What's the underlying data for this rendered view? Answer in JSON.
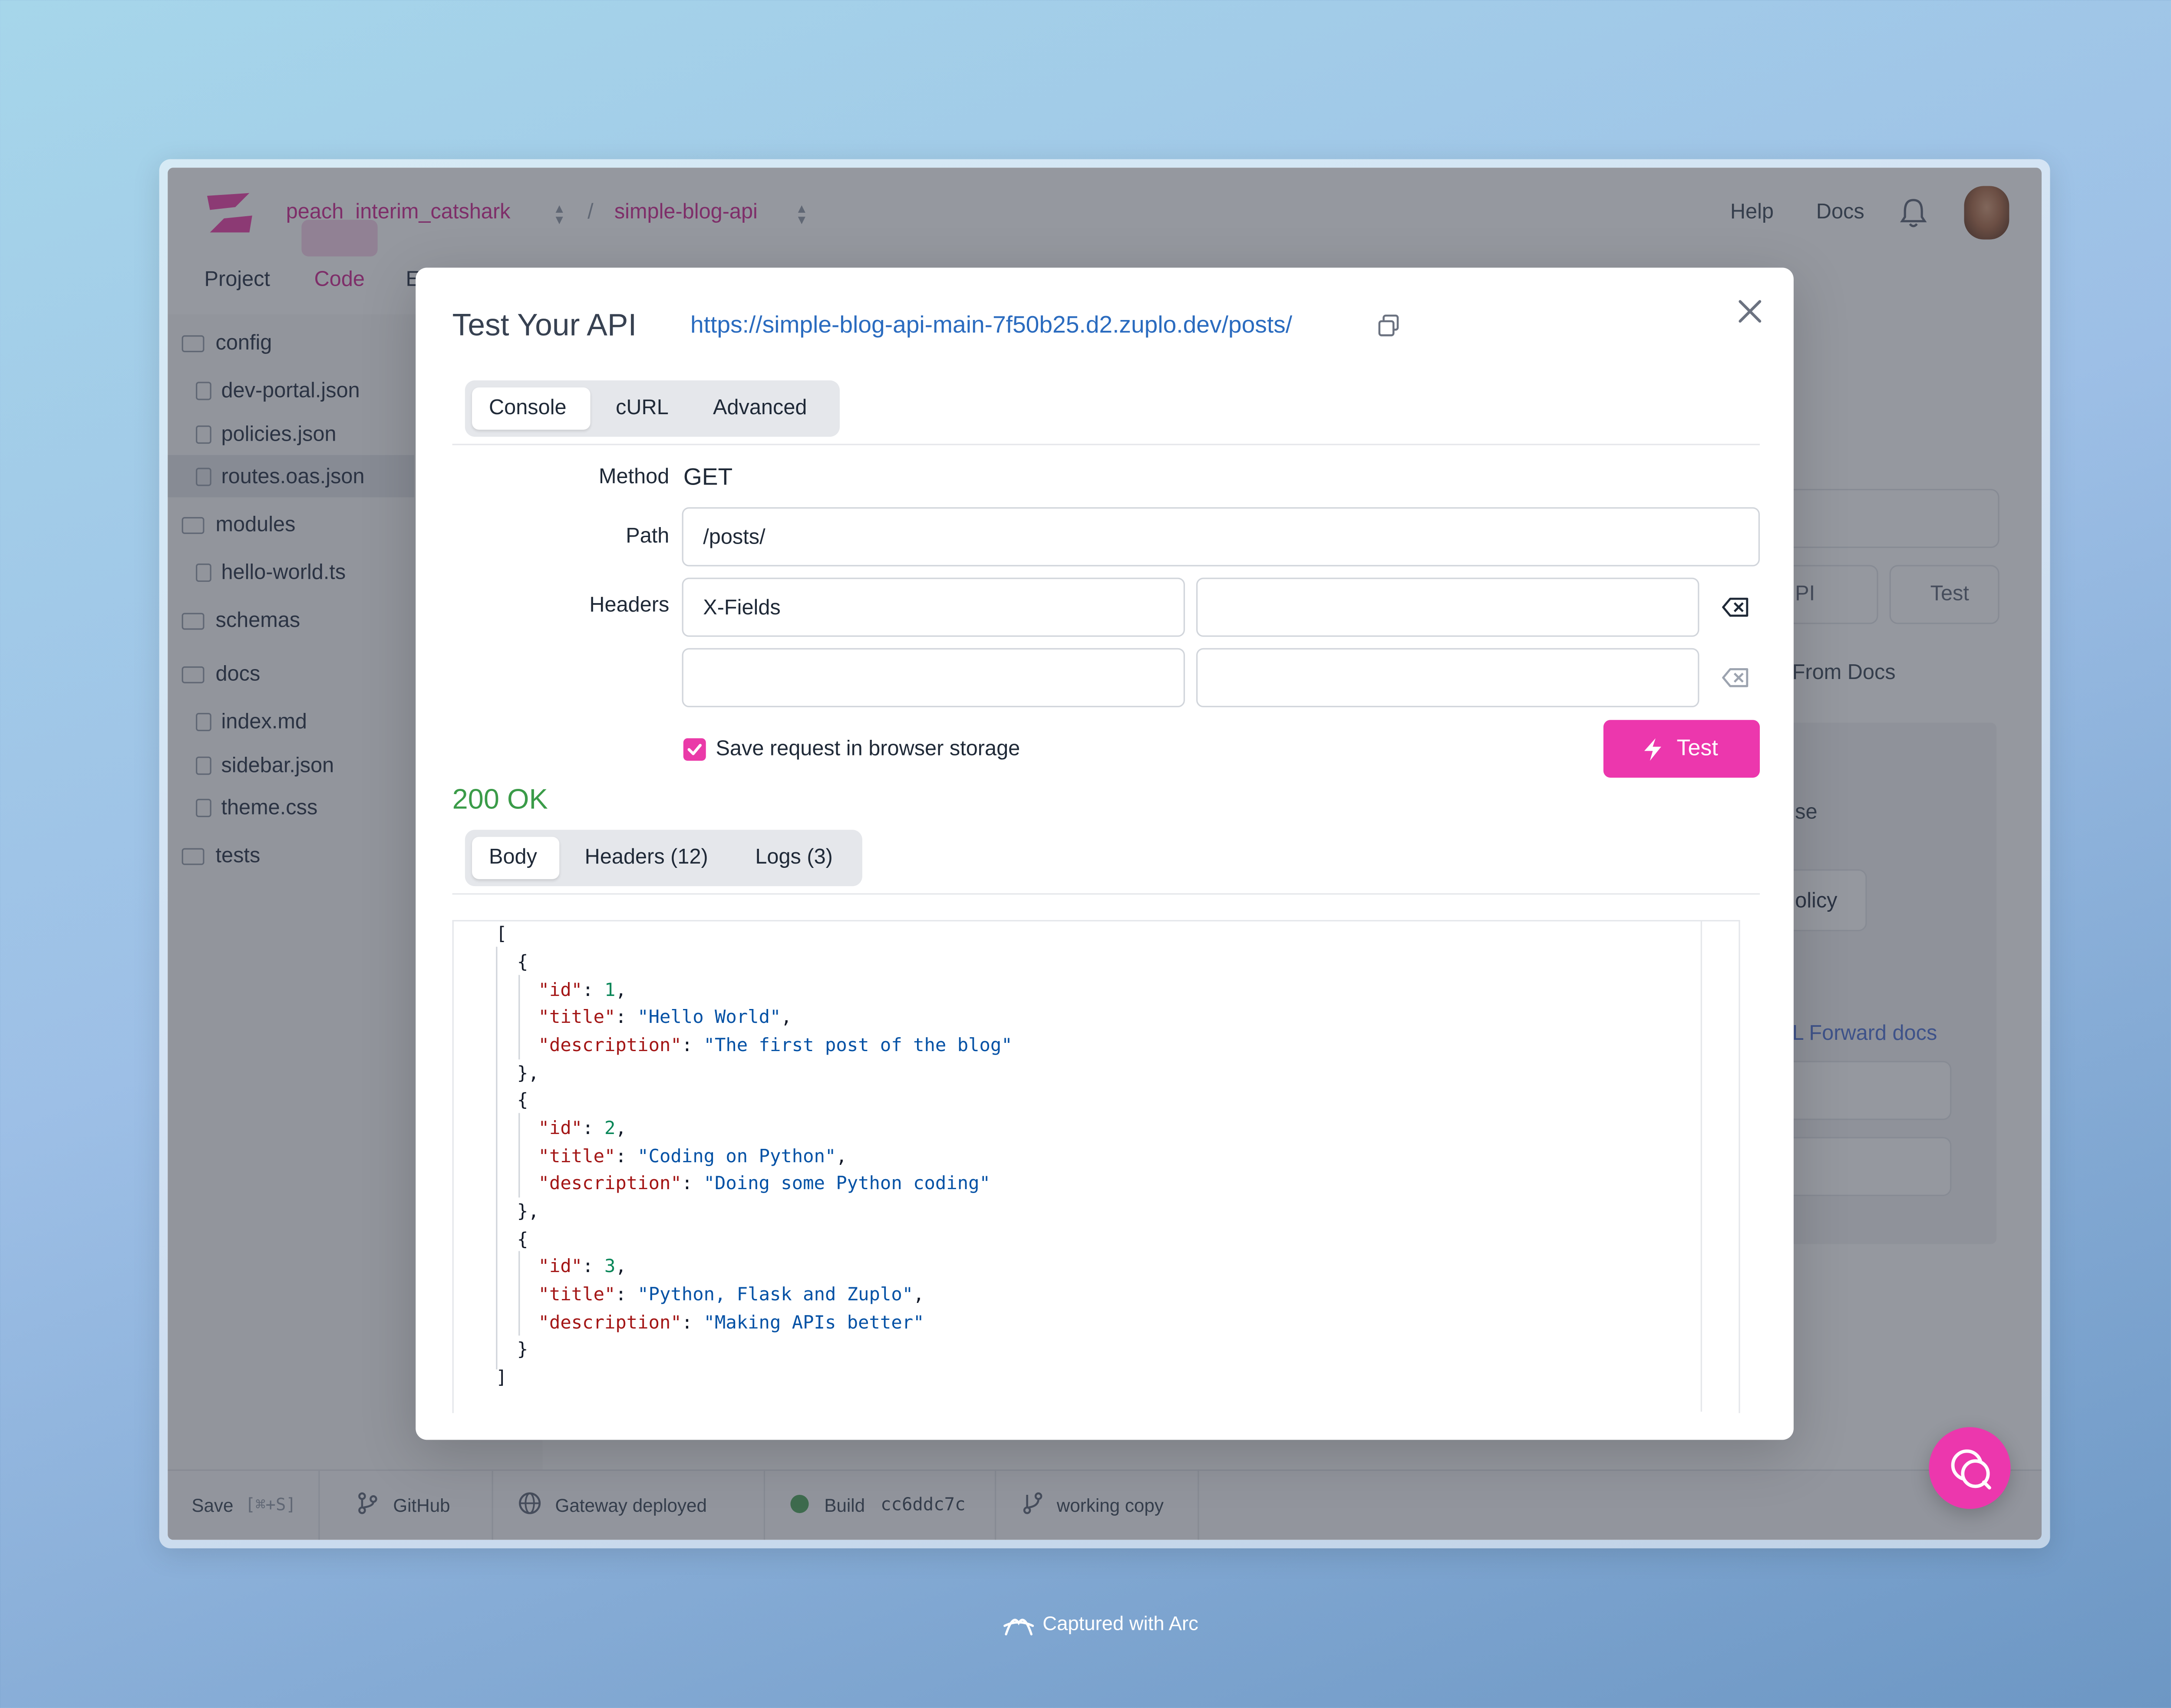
{
  "header": {
    "org": "peach_interim_catshark",
    "project": "simple-blog-api",
    "separator": "/",
    "help": "Help",
    "docs": "Docs"
  },
  "top_tabs": [
    "Project",
    "Code",
    "E"
  ],
  "sidebar": {
    "items": [
      {
        "label": "config",
        "type": "folder"
      },
      {
        "label": "dev-portal.json",
        "type": "file"
      },
      {
        "label": "policies.json",
        "type": "file"
      },
      {
        "label": "routes.oas.json",
        "type": "file",
        "selected": true
      },
      {
        "label": "modules",
        "type": "folder"
      },
      {
        "label": "hello-world.ts",
        "type": "file"
      },
      {
        "label": "schemas",
        "type": "folder"
      },
      {
        "label": "docs",
        "type": "folder"
      },
      {
        "label": "index.md",
        "type": "file"
      },
      {
        "label": "sidebar.json",
        "type": "file"
      },
      {
        "label": "theme.css",
        "type": "file"
      },
      {
        "label": "tests",
        "type": "folder"
      }
    ]
  },
  "background_panel": {
    "select_suffix": "PI",
    "test_label": "Test",
    "from_docs": "From Docs",
    "se_fragment": "se",
    "policy_fragment": "olicy",
    "forward_docs": "L Forward docs"
  },
  "footer": {
    "save": "Save",
    "save_shortcut": "[⌘+S]",
    "github": "GitHub",
    "gateway": "Gateway deployed",
    "build": "Build",
    "build_hash": "cc6ddc7c",
    "branch": "working copy"
  },
  "modal": {
    "title": "Test Your API",
    "url": "https://simple-blog-api-main-7f50b25.d2.zuplo.dev/posts/",
    "tabs": [
      "Console",
      "cURL",
      "Advanced"
    ],
    "active_tab": "Console",
    "method_label": "Method",
    "method_value": "GET",
    "path_label": "Path",
    "path_value": "/posts/",
    "headers_label": "Headers",
    "headers": [
      {
        "name": "X-Fields",
        "value": ""
      },
      {
        "name": "",
        "value": ""
      }
    ],
    "save_checkbox_label": "Save request in browser storage",
    "save_checked": true,
    "test_button": "Test",
    "status": "200  OK",
    "response_tabs": [
      "Body",
      "Headers (12)",
      "Logs (3)"
    ],
    "active_response_tab": "Body",
    "posts": [
      {
        "id": "1",
        "title": "\"Hello World\"",
        "description": "\"The first post of the blog\""
      },
      {
        "id": "2",
        "title": "\"Coding on Python\"",
        "description": "\"Doing some Python coding\""
      },
      {
        "id": "3",
        "title": "\"Python, Flask and Zuplo\"",
        "description": "\"Making APIs better\""
      }
    ],
    "code_tokens": {
      "open_array": "[",
      "close_array": "]",
      "open_obj": "{",
      "close_obj_comma": "},",
      "close_obj": "}",
      "key_id": "\"id\"",
      "key_title": "\"title\"",
      "key_description": "\"description\""
    }
  },
  "capture_caption": "Captured with Arc",
  "colors": {
    "brand_pink": "#ec37ad",
    "status_green": "#3a9b48",
    "link_blue": "#2a6bbf"
  }
}
